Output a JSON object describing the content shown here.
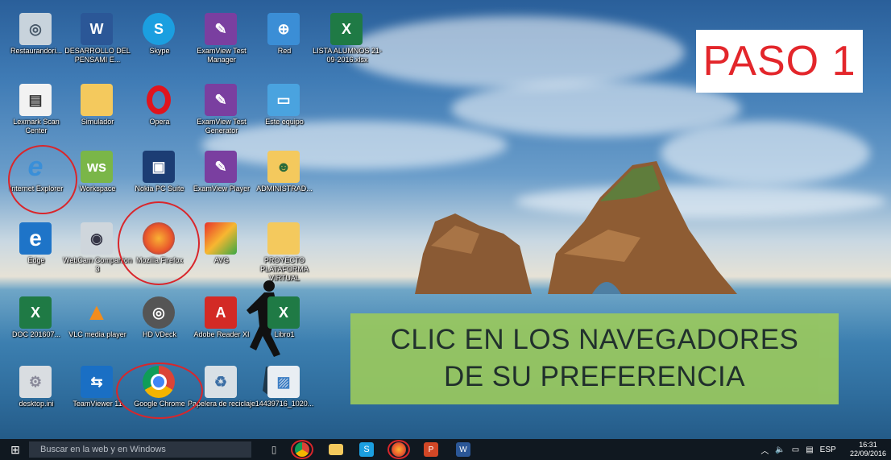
{
  "overlay": {
    "step": "PASO 1",
    "instruction_line1": "CLIC EN  LOS NAVEGADORES",
    "instruction_line2": "DE SU PREFERENCIA"
  },
  "desktop_icons": {
    "restaurando": "Restaurandori...",
    "desarrollo": "DESARROLLO DEL PENSAMI E...",
    "skype": "Skype",
    "examview_test_manager": "ExamView Test Manager",
    "red": "Red",
    "lista_alumnos": "LISTA ALUMNOS 21-09-2016.xlsx",
    "lexmark": "Lexmark Scan Center",
    "simulador": "Simulador",
    "opera": "Opera",
    "examview_test_generator": "ExamView Test Generator",
    "este_equipo": "Este equipo",
    "internet_explorer": "Internet Explorer",
    "workspace": "Workspace",
    "nokia_pc_suite": "Nokia PC Suite",
    "examview_player": "ExamView Player",
    "administrador": "ADMINISTRAD...",
    "edge": "Edge",
    "webcam": "WebCam Companion 3",
    "firefox": "Mozilla Firefox",
    "avg": "AVG",
    "proyecto": "PROYECTO PLATAFORMA VIRTUAL",
    "doc": "DOC 201607...",
    "vlc": "VLC media player",
    "hd_video": "HD VDeck",
    "adobe": "Adobe Reader XI",
    "libro": "Libro1",
    "desktop_ini": "desktop.ini",
    "teamviewer": "TeamViewer 11",
    "chrome": "Google Chrome",
    "papelera": "Papelera de reciclaje",
    "image_file": "14439716_1020..."
  },
  "taskbar": {
    "search_placeholder": "Buscar en la web y en Windows",
    "language": "ESP",
    "time": "16:31",
    "date": "22/09/2016"
  },
  "colors": {
    "accent_red": "#e3262b",
    "instruction_bg": "#9ac95e",
    "taskbar": "#101820"
  }
}
